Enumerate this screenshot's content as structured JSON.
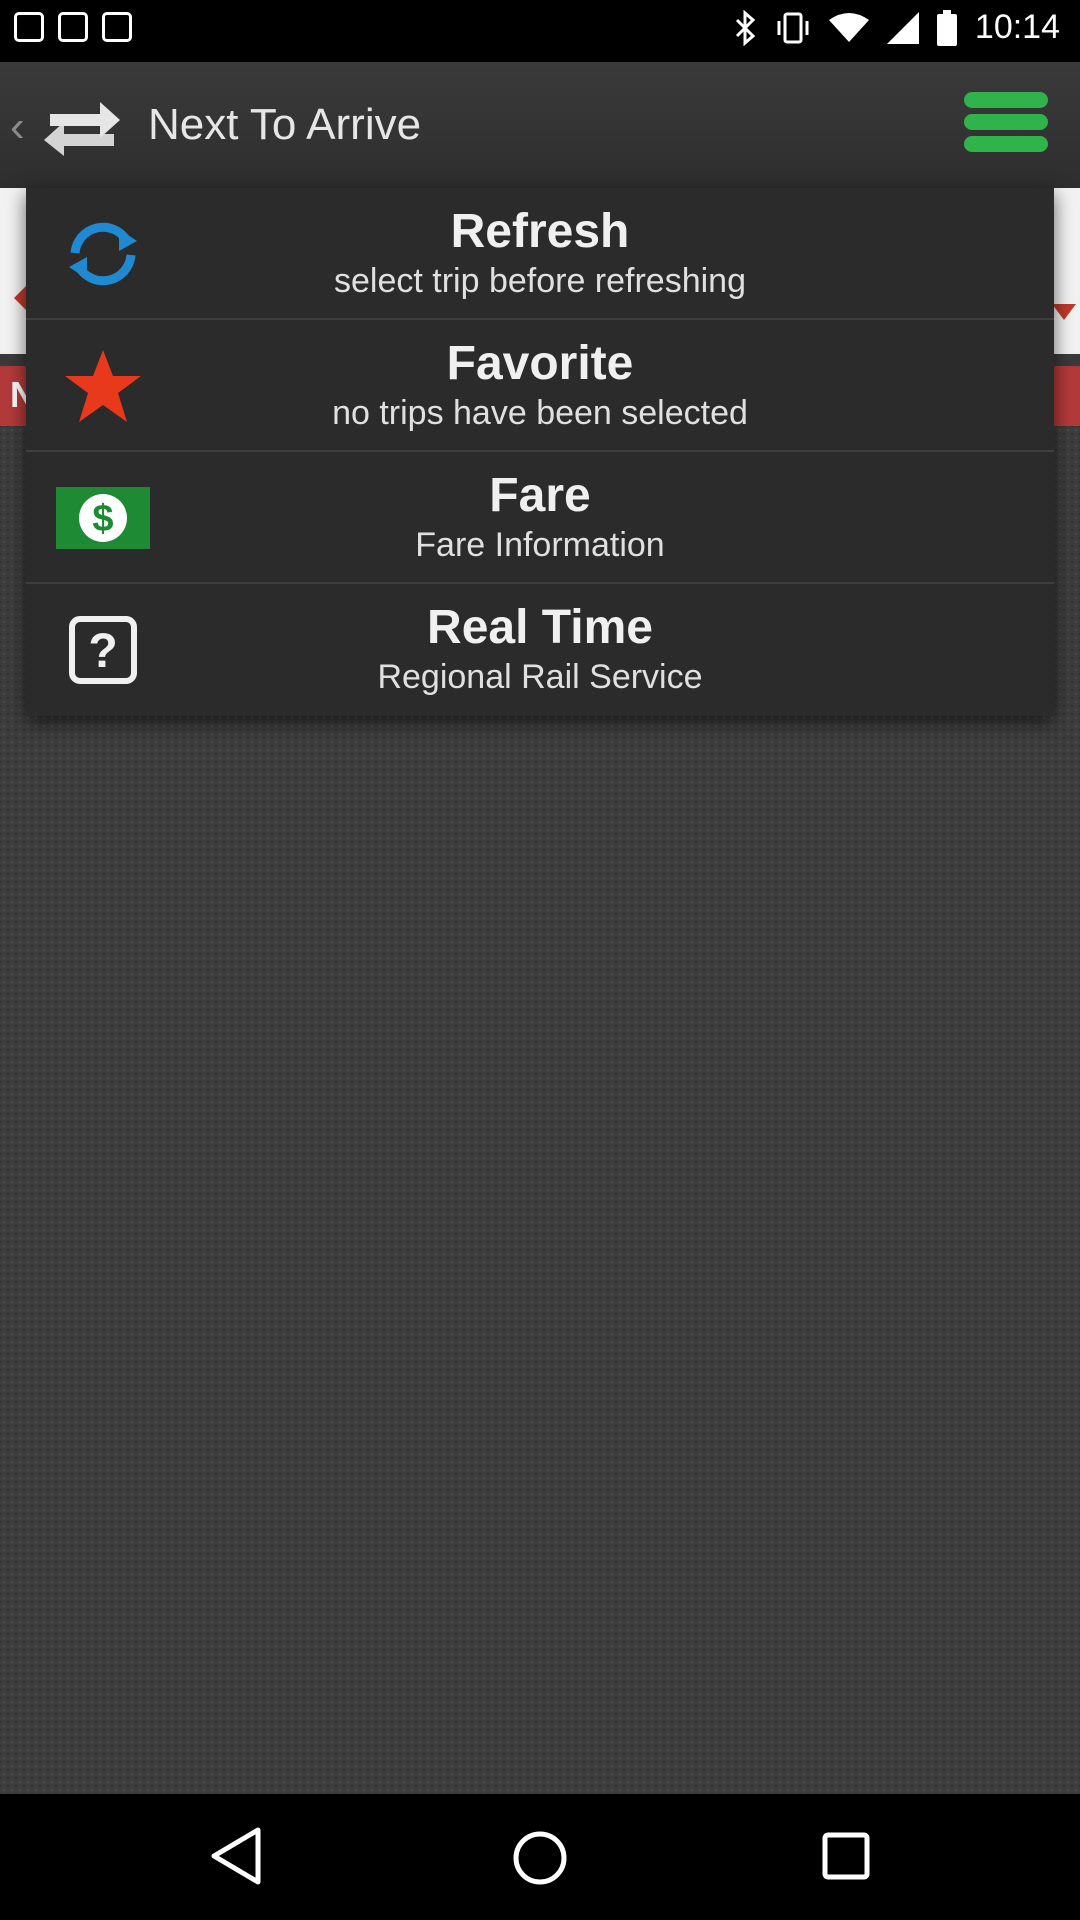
{
  "status_bar": {
    "time": "10:14",
    "icons": [
      "notification-icon",
      "notification-icon",
      "notification-icon",
      "bluetooth-icon",
      "vibrate-icon",
      "wifi-icon",
      "signal-icon",
      "battery-icon"
    ]
  },
  "action_bar": {
    "title": "Next To Arrive",
    "icons": [
      "back-chevron-icon",
      "swap-arrows-icon",
      "menu-icon"
    ]
  },
  "background": {
    "red_bar_initial": "N"
  },
  "menu": {
    "items": [
      {
        "title": "Refresh",
        "subtitle": "select trip before refreshing",
        "icon": "refresh-icon"
      },
      {
        "title": "Favorite",
        "subtitle": "no trips have been selected",
        "icon": "star-icon"
      },
      {
        "title": "Fare",
        "subtitle": "Fare Information",
        "icon": "dollar-icon"
      },
      {
        "title": "Real Time",
        "subtitle": "Regional Rail Service",
        "icon": "question-icon"
      }
    ]
  },
  "colors": {
    "accent_green": "#2fb34a",
    "refresh_blue": "#1f8ad2",
    "star_red": "#e8391c",
    "menu_bg": "#2b2b2b"
  },
  "nav_bar": {
    "icons": [
      "back-triangle-icon",
      "home-circle-icon",
      "recents-square-icon"
    ]
  }
}
